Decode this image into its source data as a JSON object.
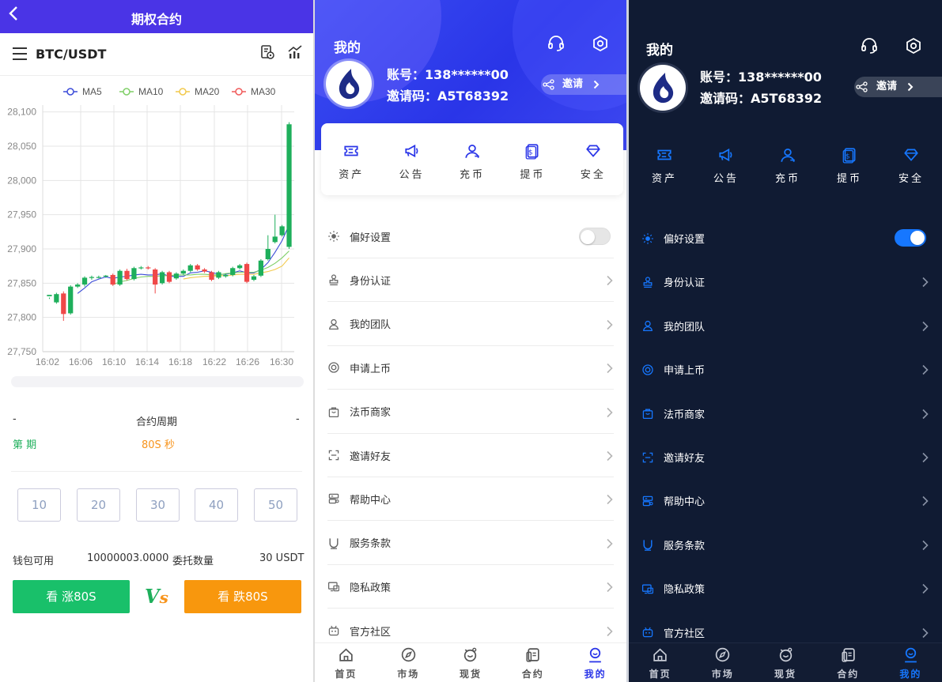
{
  "contract": {
    "title": "期权合约",
    "pair": "BTC/USDT",
    "legend": [
      {
        "name": "MA5",
        "color": "#3b4bd8"
      },
      {
        "name": "MA10",
        "color": "#7fcf67"
      },
      {
        "name": "MA20",
        "color": "#f2c94c"
      },
      {
        "name": "MA30",
        "color": "#f05a5a"
      }
    ],
    "period_left": "-",
    "period_label": "合约周期",
    "period_right": "-",
    "period_name": "第 期",
    "period_value": "80S 秒",
    "options": [
      "10",
      "20",
      "30",
      "40",
      "50"
    ],
    "wallet_label": "钱包可用",
    "wallet_value": "10000003.0000",
    "order_label": "委托数量",
    "order_value": "30 USDT",
    "buy_up": "看 涨80S",
    "vs_v": "V",
    "vs_s": "s",
    "buy_down": "看 跌80S"
  },
  "chart_data": {
    "type": "candlestick",
    "x_ticks": [
      "16:02",
      "16:06",
      "16:10",
      "16:14",
      "16:18",
      "16:22",
      "16:26",
      "16:30"
    ],
    "y_ticks": [
      "28,100",
      "28,050",
      "28,000",
      "27,950",
      "27,900",
      "27,850",
      "27,800",
      "27,750"
    ],
    "ylim": [
      27750,
      28110
    ],
    "grid": true,
    "legend_position": "top",
    "up_color": "#1eaf5b",
    "down_color": "#f04848",
    "candles": [
      [
        27831,
        27833,
        27829,
        27827
      ],
      [
        27822,
        27834,
        27836,
        27820
      ],
      [
        27835,
        27805,
        27838,
        27795
      ],
      [
        27806,
        27845,
        27847,
        27804
      ],
      [
        27845,
        27848,
        27850,
        27843
      ],
      [
        27848,
        27858,
        27860,
        27845
      ],
      [
        27858,
        27859,
        27861,
        27855
      ],
      [
        27859,
        27859,
        27861,
        27857
      ],
      [
        27860,
        27861,
        27862,
        27858
      ],
      [
        27862,
        27848,
        27864,
        27846
      ],
      [
        27848,
        27868,
        27870,
        27846
      ],
      [
        27868,
        27856,
        27871,
        27854
      ],
      [
        27856,
        27872,
        27874,
        27854
      ],
      [
        27872,
        27873,
        27875,
        27870
      ],
      [
        27873,
        27872,
        27875,
        27870
      ],
      [
        27870,
        27848,
        27872,
        27835
      ],
      [
        27850,
        27866,
        27868,
        27848
      ],
      [
        27866,
        27852,
        27868,
        27850
      ],
      [
        27857,
        27864,
        27866,
        27855
      ],
      [
        27864,
        27868,
        27870,
        27862
      ],
      [
        27868,
        27876,
        27878,
        27866
      ],
      [
        27876,
        27870,
        27878,
        27868
      ],
      [
        27870,
        27867,
        27872,
        27865
      ],
      [
        27866,
        27855,
        27868,
        27853
      ],
      [
        27858,
        27866,
        27868,
        27856
      ],
      [
        27860,
        27862,
        27864,
        27858
      ],
      [
        27862,
        27872,
        27874,
        27860
      ],
      [
        27872,
        27876,
        27878,
        27870
      ],
      [
        27878,
        27852,
        27880,
        27850
      ],
      [
        27855,
        27860,
        27862,
        27853
      ],
      [
        27861,
        27883,
        27885,
        27859
      ],
      [
        27885,
        27900,
        27920,
        27883
      ],
      [
        27910,
        27918,
        27950,
        27908
      ],
      [
        27920,
        27933,
        27935,
        27918
      ],
      [
        27903,
        28082,
        28085,
        27900
      ]
    ],
    "ma": [
      {
        "name": "MA5",
        "color": "#3b4bd8",
        "values": [
          null,
          null,
          null,
          null,
          27835,
          27843,
          27852,
          27856,
          27859,
          27857,
          27859,
          27860,
          27862,
          27863,
          27862,
          27862,
          27864,
          27860,
          27860,
          27860,
          27865,
          27866,
          27868,
          27866,
          27863,
          27863,
          27865,
          27868,
          27865,
          27865,
          27870,
          27880,
          27895,
          27912,
          27935
        ]
      },
      {
        "name": "MA10",
        "color": "#7fcf67",
        "values": [
          null,
          null,
          null,
          null,
          null,
          null,
          null,
          null,
          null,
          27848,
          27852,
          27854,
          27857,
          27859,
          27860,
          27860,
          27861,
          27861,
          27862,
          27862,
          27862,
          27863,
          27863,
          27862,
          27862,
          27864,
          27865,
          27866,
          27866,
          27866,
          27869,
          27873,
          27879,
          27887,
          27897
        ]
      },
      {
        "name": "MA20",
        "color": "#f2c94c",
        "values": [
          null,
          null,
          null,
          null,
          null,
          null,
          null,
          null,
          null,
          null,
          null,
          null,
          null,
          null,
          null,
          null,
          null,
          null,
          null,
          27856,
          27858,
          27859,
          27860,
          27860,
          27861,
          27861,
          27862,
          27863,
          27863,
          27863,
          27865,
          27867,
          27870,
          27875,
          27887
        ]
      }
    ]
  },
  "profile": {
    "title": "我的",
    "account_line": "账号：138******00",
    "invite_code_line": "邀请码：A5T68392",
    "invite_button": "邀请",
    "quick": [
      {
        "label": "资产",
        "icon": "ticket-icon"
      },
      {
        "label": "公告",
        "icon": "megaphone-icon"
      },
      {
        "label": "充币",
        "icon": "user-icon"
      },
      {
        "label": "提币",
        "icon": "withdraw-icon"
      },
      {
        "label": "安全",
        "icon": "diamond-icon"
      }
    ],
    "menu": [
      {
        "label": "偏好设置",
        "icon": "sun-icon"
      },
      {
        "label": "身份认证",
        "icon": "stamp-icon"
      },
      {
        "label": "我的团队",
        "icon": "person-icon"
      },
      {
        "label": "申请上币",
        "icon": "coin-icon"
      },
      {
        "label": "法币商家",
        "icon": "bag-icon"
      },
      {
        "label": "邀请好友",
        "icon": "scan-icon"
      },
      {
        "label": "帮助中心",
        "icon": "server-icon"
      },
      {
        "label": "服务条款",
        "icon": "magnet-icon"
      },
      {
        "label": "隐私政策",
        "icon": "screen-icon"
      },
      {
        "label": "官方社区",
        "icon": "robot-icon"
      }
    ],
    "nav": [
      {
        "label": "首页",
        "icon": "home-icon"
      },
      {
        "label": "市场",
        "icon": "compass-icon"
      },
      {
        "label": "现货",
        "icon": "spot-icon"
      },
      {
        "label": "合约",
        "icon": "contract-icon"
      },
      {
        "label": "我的",
        "icon": "mine-icon"
      }
    ],
    "light_theme": {
      "accent": "#2a35e8",
      "text": "#333333",
      "active_nav": "#2a35e8",
      "toggle_on": false
    },
    "dark_theme": {
      "accent": "#1677ff",
      "text": "#ffffff",
      "active_nav": "#1677ff",
      "toggle_on": true
    }
  }
}
